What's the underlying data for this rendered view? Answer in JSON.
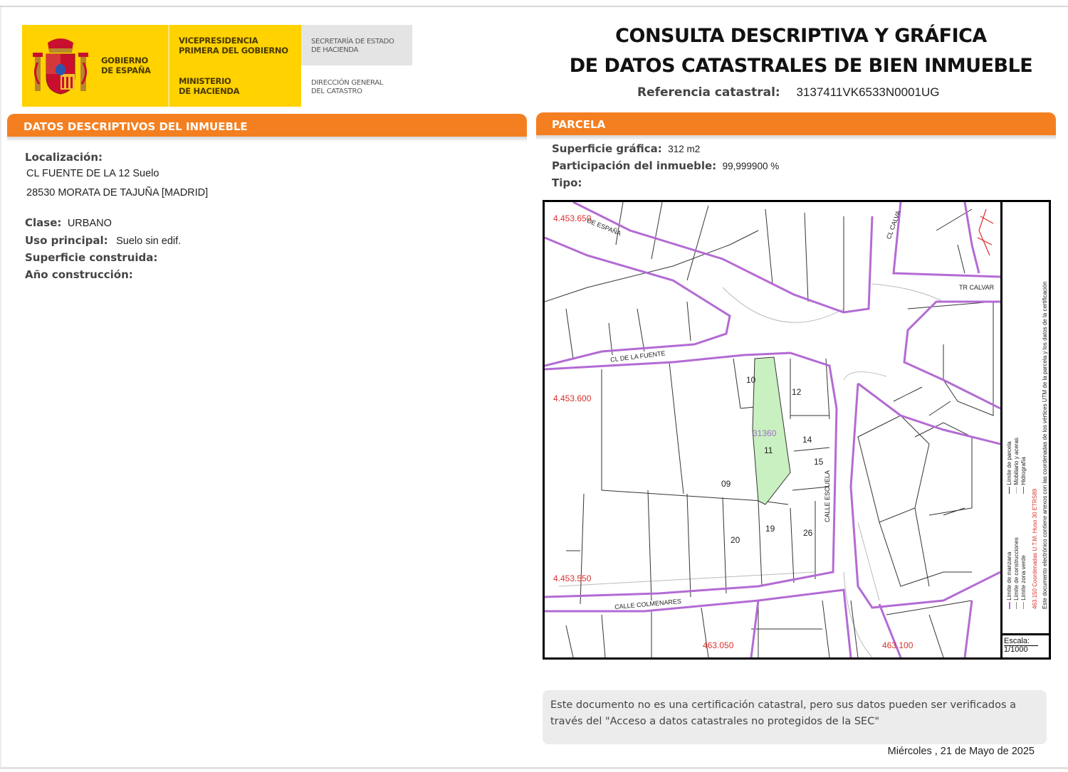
{
  "logo": {
    "gobierno": [
      "GOBIERNO",
      "DE ESPAÑA"
    ],
    "vicepresidencia": [
      "VICEPRESIDENCIA",
      "PRIMERA DEL GOBIERNO"
    ],
    "ministerio": [
      "MINISTERIO",
      "DE HACIENDA"
    ],
    "secretaria": [
      "SECRETARÍA DE ESTADO",
      "DE HACIENDA"
    ],
    "direccion": [
      "DIRECCIÓN GENERAL",
      "DEL CATASTRO"
    ]
  },
  "header": {
    "title_line1": "CONSULTA DESCRIPTIVA Y GRÁFICA",
    "title_line2": "DE DATOS CATASTRALES DE BIEN INMUEBLE",
    "ref_label": "Referencia catastral:",
    "ref_value": "3137411VK6533N0001UG"
  },
  "left_section": {
    "title": "DATOS DESCRIPTIVOS DEL INMUEBLE",
    "localizacion_label": "Localización:",
    "address_line1": "CL FUENTE DE LA 12 Suelo",
    "address_line2": "28530 MORATA DE TAJUÑA [MADRID]",
    "clase_label": "Clase:",
    "clase_value": "URBANO",
    "uso_label": "Uso principal:",
    "uso_value": "Suelo sin edif.",
    "superficie_label": "Superficie construida:",
    "anio_label": "Año construcción:"
  },
  "right_section": {
    "title": "PARCELA",
    "superficie_label": "Superficie gráfica:",
    "superficie_value": "312 m2",
    "participacion_label": "Participación del inmueble:",
    "participacion_value": "99,999900 %",
    "tipo_label": "Tipo:"
  },
  "map": {
    "coord_labels": [
      "4.453.650",
      "4.453.600",
      "4.453.550",
      "463.050",
      "463.100"
    ],
    "street_names": [
      "CL DE LA FUENTE",
      "CALLE ESCUELA",
      "CALLE COLMENARES",
      "CL CALVA",
      "TR CALVAR",
      "DE ESPAÑA"
    ],
    "parcel_numbers": [
      "10",
      "12",
      "14",
      "15",
      "11",
      "09",
      "19",
      "26",
      "20"
    ],
    "highlight_label": "31360",
    "scale_label": "Escala:",
    "scale_value": "1/1000",
    "legend": [
      "Límite de manzana",
      "Límite de parcela",
      "Límite de construcciones",
      "Mobiliario y aceras",
      "Límite zona verde",
      "Hidrografía"
    ],
    "legend_note": "463.150 Coordenadas U.T.M. Huso 30 ETRS89",
    "legend_doc": "Este documento electrónico contiene anexos con las coordenadas de los vértices UTM de la parcela y los datos de la certificación",
    "colors": {
      "block": "#b36bd4",
      "parcel": "#222222",
      "highlight": "#c9f0c0",
      "coords": "#d9302b"
    }
  },
  "notice": {
    "text": "Este documento no es una certificación catastral, pero sus datos pueden ser verificados a través del \"Acceso a datos catastrales no protegidos de la SEC\""
  },
  "footer": {
    "date": "Miércoles , 21 de Mayo de 2025"
  }
}
